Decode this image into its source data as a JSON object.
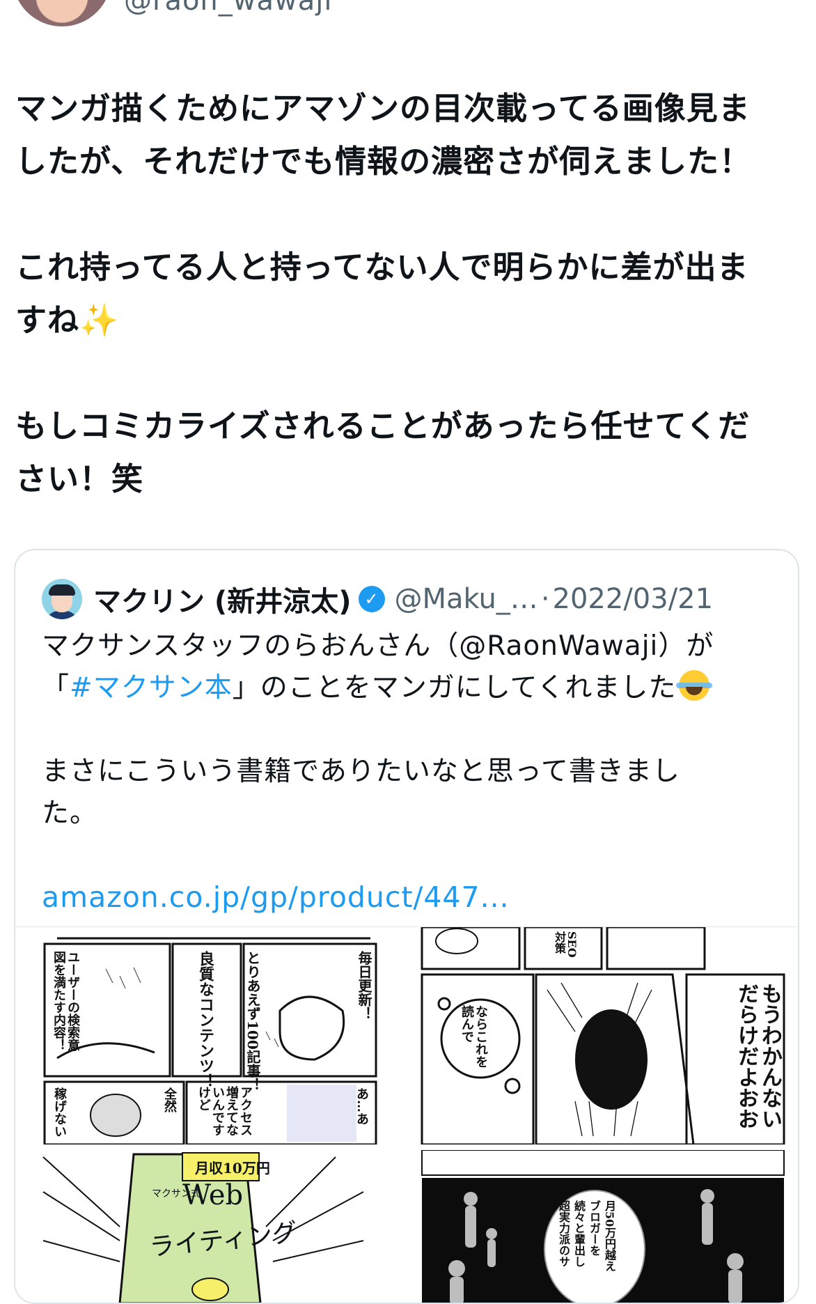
{
  "author": {
    "handle": "@raon_wawaji"
  },
  "tweet": {
    "line1": "マンガ描くためにアマゾンの目次載ってる画像見ま",
    "line2": "したが、それだけでも情報の濃密さが伺えました！",
    "line3": "これ持ってる人と持ってない人で明らかに差が出ま",
    "line4": "すね",
    "line4_emoji": "✨",
    "line5": "もしコミカライズされることがあったら任せてくだ",
    "line6": "さい！笑"
  },
  "quoted": {
    "name": "マクリン (新井涼太)",
    "verified_mark": "✓",
    "handle": "@Maku_…",
    "dot": "·",
    "date": "2022/03/21",
    "line1": "マクサンスタッフのらおんさん（@RaonWawaji）が",
    "line2_open": "「",
    "hashtag": "#マクサン本",
    "line2_rest": "」のことをマンガにしてくれました",
    "line3": "まさにこういう書籍でありたいなと思って書きまし",
    "line4": "た。",
    "link": "amazon.co.jp/gp/product/447..."
  },
  "media": {
    "panel1": {
      "a": "毎日更新！",
      "b": "とりあえず100記事！",
      "c": "良質なコンテンツ！",
      "d": "ユーザーの検索意図を満たす内容！",
      "e": "稼げない",
      "f": "全然",
      "g": "アクセス増えてないんですけど",
      "h": "あ…あ"
    },
    "panel2": {
      "a": "もうわかんないだらけだよおお",
      "b": "ならこれを読んで",
      "c": "SEO対策"
    },
    "panel3": {
      "a": "月収10万円",
      "b": "Web",
      "c": "ライティング",
      "d": "マクサン式"
    },
    "panel4": {
      "a": "月50万円越え",
      "b": "ブロガーを",
      "c": "続々と輩出し",
      "d": "超実力派のサ"
    }
  }
}
